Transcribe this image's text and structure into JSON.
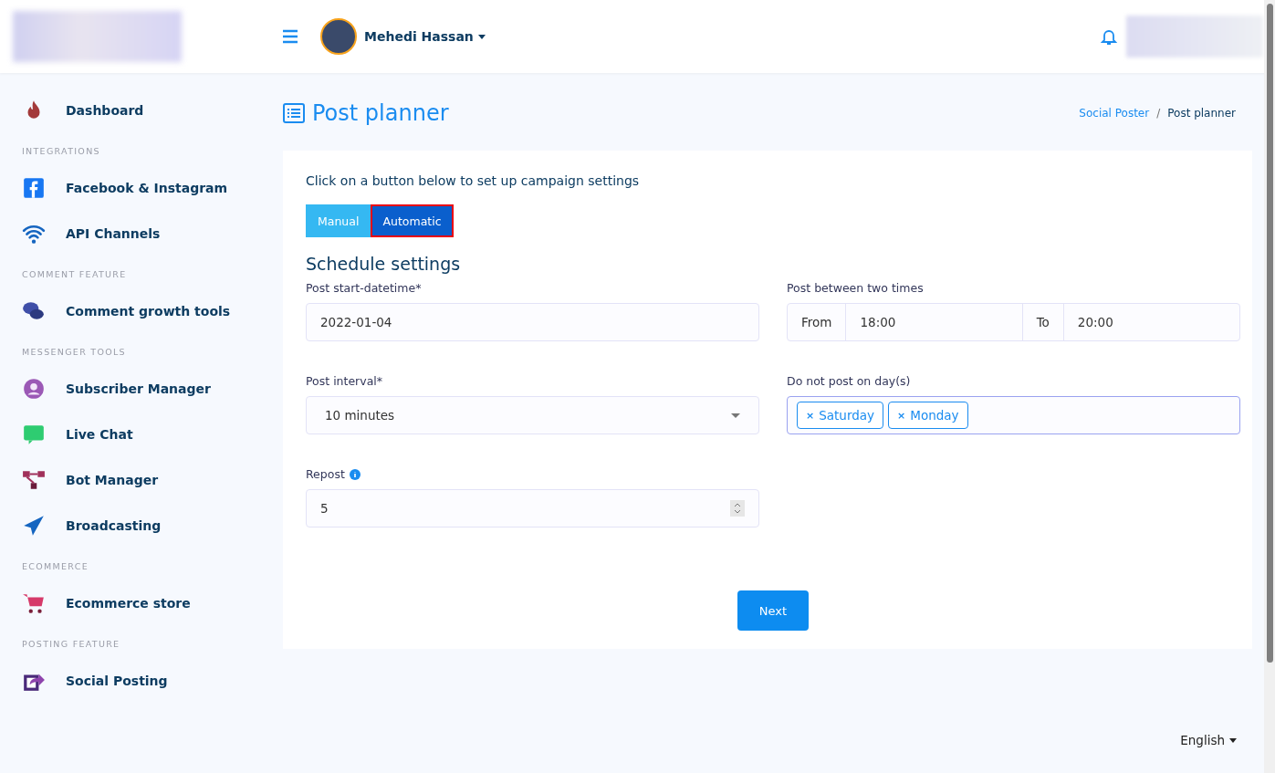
{
  "header": {
    "user_name": "Mehedi Hassan"
  },
  "sidebar": {
    "top_item": {
      "label": "Dashboard"
    },
    "sections": [
      {
        "title": "INTEGRATIONS",
        "items": [
          {
            "label": "Facebook & Instagram"
          },
          {
            "label": "API Channels"
          }
        ]
      },
      {
        "title": "COMMENT FEATURE",
        "items": [
          {
            "label": "Comment growth tools"
          }
        ]
      },
      {
        "title": "MESSENGER TOOLS",
        "items": [
          {
            "label": "Subscriber Manager"
          },
          {
            "label": "Live Chat"
          },
          {
            "label": "Bot Manager"
          },
          {
            "label": "Broadcasting"
          }
        ]
      },
      {
        "title": "ECOMMERCE",
        "items": [
          {
            "label": "Ecommerce store"
          }
        ]
      },
      {
        "title": "POSTING FEATURE",
        "items": [
          {
            "label": "Social Posting"
          }
        ]
      }
    ]
  },
  "page_title": "Post planner",
  "breadcrumb": {
    "separator": "/",
    "items": [
      {
        "label": "Social Poster",
        "kind": "link"
      },
      {
        "label": "Post planner",
        "kind": "current"
      }
    ]
  },
  "card": {
    "intro": "Click on a button below to set up campaign settings",
    "mode_buttons": [
      {
        "label": "Manual",
        "selected": false
      },
      {
        "label": "Automatic",
        "selected": true
      }
    ],
    "section_title": "Schedule settings",
    "start_datetime": {
      "label": "Post start-datetime*",
      "value": "2022-01-04"
    },
    "between_times": {
      "label": "Post between two times",
      "from_label": "From",
      "from_value": "18:00",
      "to_label": "To",
      "to_value": "20:00"
    },
    "interval": {
      "label": "Post interval*",
      "value": "10 minutes"
    },
    "excluded_days": {
      "label": "Do not post on day(s)",
      "remove_mark": "×",
      "tags": [
        "Saturday",
        "Monday"
      ]
    },
    "repost": {
      "label": "Repost",
      "value": "5"
    },
    "next_button": "Next"
  },
  "footer": {
    "language": "English"
  }
}
